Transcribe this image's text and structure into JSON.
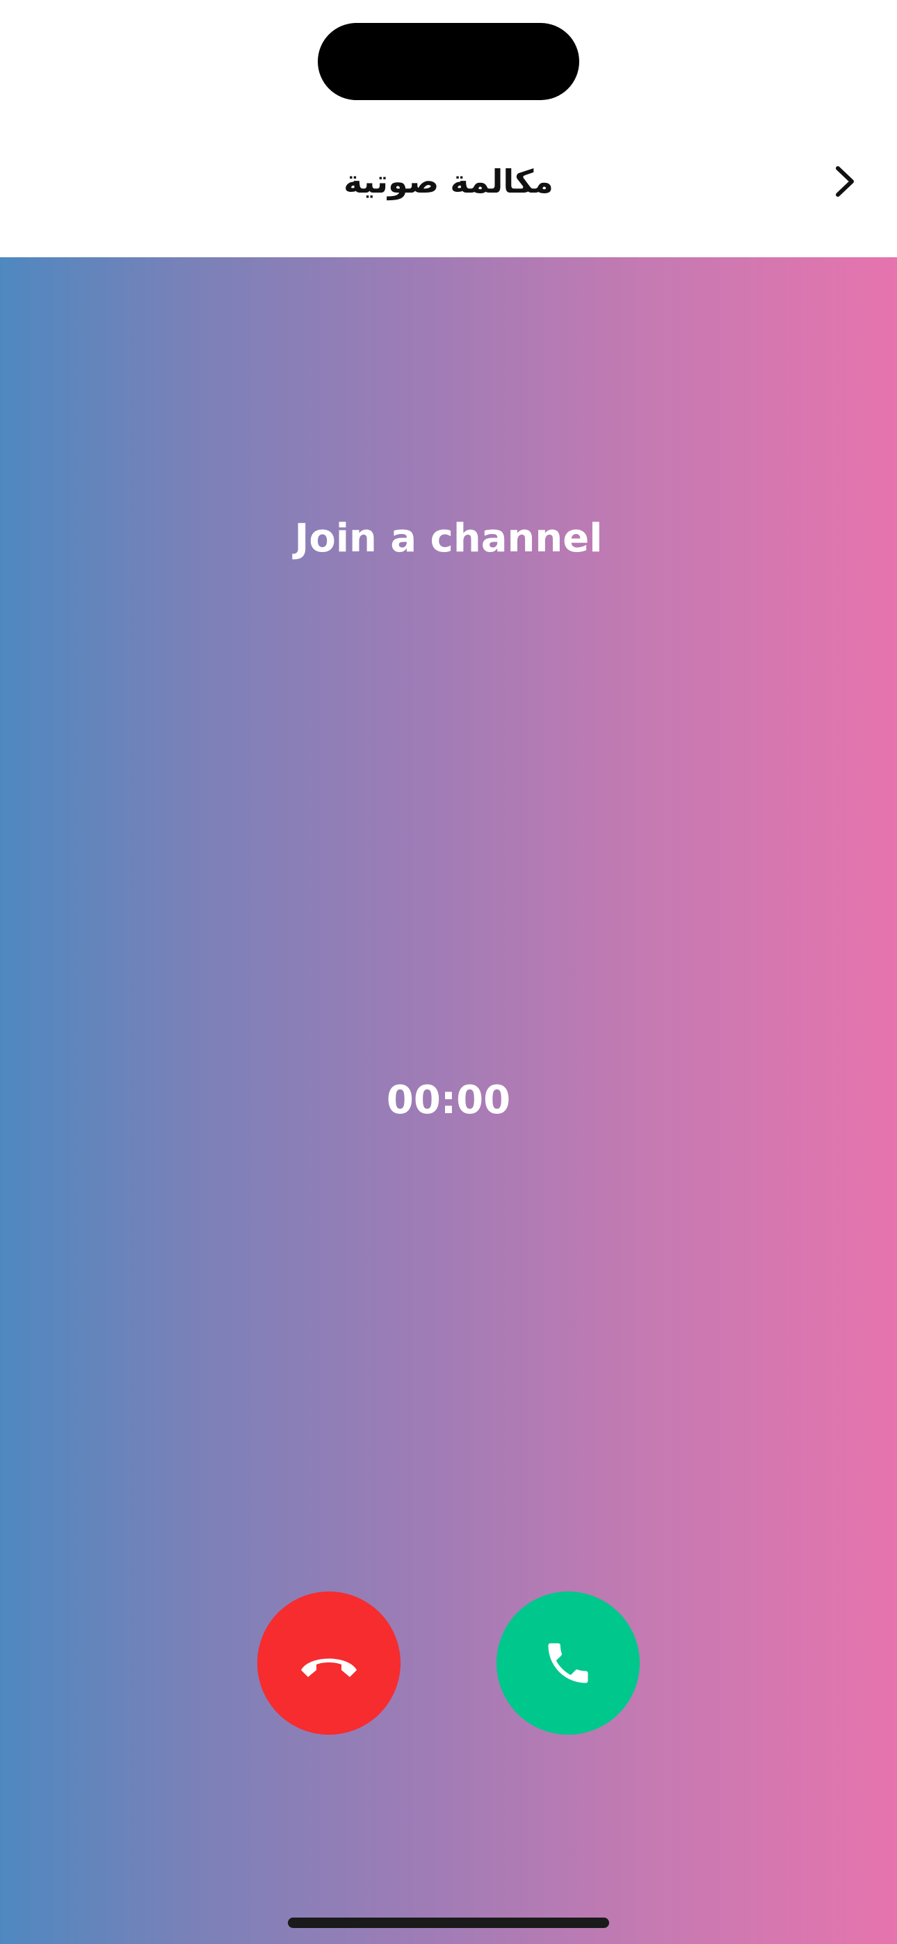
{
  "header": {
    "title": "مكالمة صوتية",
    "back_icon": "chevron-right-icon"
  },
  "call": {
    "channel_label": "Join a channel",
    "timer": "00:00",
    "gradient_colors": [
      "#4f88c0",
      "#a07cb6",
      "#e674ae"
    ],
    "decline_color": "#f62c2f",
    "accept_color": "#00c78c",
    "decline_icon": "hang-up-icon",
    "accept_icon": "phone-icon"
  }
}
